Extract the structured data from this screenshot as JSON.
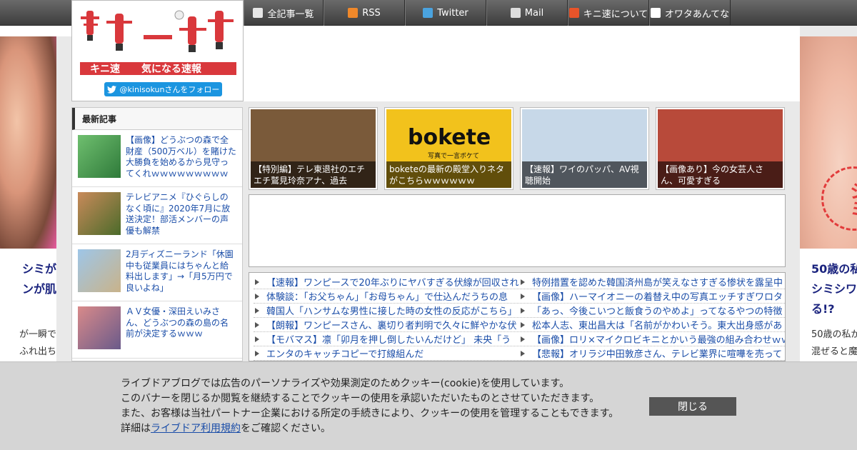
{
  "nav": {
    "items": [
      {
        "label": "全記事一覧",
        "icon": "document-icon",
        "color": "#e6e6e6",
        "width": 112
      },
      {
        "label": "RSS",
        "icon": "rss-icon",
        "color": "#f0882a",
        "width": 114
      },
      {
        "label": "Twitter",
        "icon": "twitter-icon",
        "color": "#4aa3df",
        "width": 114
      },
      {
        "label": "Mail",
        "icon": "mail-icon",
        "color": "#dddddd",
        "width": 114
      },
      {
        "label": "キニ速について",
        "icon": "kini-logo-icon",
        "color": "#e8542a",
        "width": 114
      },
      {
        "label": "オワタあんてな",
        "icon": "face-icon",
        "color": "#ffffff",
        "width": 114
      }
    ]
  },
  "logo": {
    "name": "キニ速",
    "tagline": "気になる速報",
    "follow_label": "@kinisokunさんをフォロー"
  },
  "left_ad": {
    "title_lines": [
      "シミが",
      "ンが肌"
    ],
    "text_lines": [
      "が一瞬で",
      "ふれ出ち"
    ]
  },
  "right_ad": {
    "circle_text": "シミ",
    "title_lines": [
      "50歳の私",
      "シミシワ",
      "る!?"
    ],
    "text_lines": [
      "50歳の私が",
      "混ぜると魔"
    ]
  },
  "recent": {
    "header": "最新記事",
    "items": [
      {
        "title": "【画像】どうぶつの森で全財産（500万ベル）を賭けた大勝負を始めるから見守ってくれｗｗｗｗｗｗｗｗｗｗｗｗ",
        "thumb_colors": [
          "#6fbf6f",
          "#2f7a3a"
        ]
      },
      {
        "title": "テレビアニメ『ひぐらしのなく頃に』2020年7月に放送決定！部活メンバーの声優も解禁",
        "thumb_colors": [
          "#c98a5a",
          "#4b6b2a"
        ]
      },
      {
        "title": "2月ディズニーランド「休園中も従業員にはちゃんと給料出します」→「月5万円で良いよね」",
        "thumb_colors": [
          "#9ec6e8",
          "#c9b38a"
        ]
      },
      {
        "title": "ＡＶ女優・深田えいみさん、どうぶつの森の島の名前が決定するｗｗｗ",
        "thumb_colors": [
          "#d98a8a",
          "#6a5a8a"
        ]
      }
    ]
  },
  "featured": [
    {
      "caption": "【特別編】テレ東退社のエチエチ鷲見玲奈アナ、過去",
      "bg": "#7a5a3a"
    },
    {
      "caption": "boketeの最新の殿堂入りネタがこちらｗｗｗｗｗｗ",
      "bg": "#f2c21c",
      "brand": "bokete",
      "brand_sub": "写真で一言ボケて"
    },
    {
      "caption": "【速報】ワイのパッパ、AV視聴開始",
      "bg": "#c7d8e8"
    },
    {
      "caption": "【画像あり】今の女芸人さん、可愛すぎる",
      "bg": "#b84a3a"
    }
  ],
  "links": [
    [
      "【速報】ワンピースで20年ぶりにヤバすぎる伏線が回収され",
      "特例措置を認めた韓国済州島が笑えなさすぎる惨状を露呈中"
    ],
    [
      "体験談：「お父ちゃん」「お母ちゃん」で仕込んだうちの息",
      "【画像】ハーマイオニーの着替え中の写真エッチすぎワロタ"
    ],
    [
      "韓国人「ハンサムな男性に接した時の女性の反応がこちら」",
      "「あっ、今後こいつと飯食うのやめよ」ってなるやつの特徴"
    ],
    [
      "【朗報】ワンピースさん、裏切り者判明で久々に鮮やかな伏",
      "松本人志、東出昌大は「名前がかわいそう。東大出身感があ"
    ],
    [
      "【モバマス】凛「卯月を押し倒したいんだけど」 未央「う",
      "【画像】ロリ×マイクロビキニとかいう最強の組み合わせｗｗ"
    ],
    [
      "エンタのキャッチコピーで打線組んだ",
      "【悲報】オリラジ中田敦彦さん、テレビ業界に喧嘩を売って"
    ]
  ],
  "cookie": {
    "line1": "ライブドアブログでは広告のパーソナライズや効果測定のためクッキー(cookie)を使用しています。",
    "line2": "このバナーを閉じるか閲覧を継続することでクッキーの使用を承認いただいたものとさせていただきます。",
    "line3": "また、お客様は当社パートナー企業における所定の手続きにより、クッキーの使用を管理することもできます。",
    "line4_prefix": "詳細は",
    "line4_link": "ライブドア利用規約",
    "line4_suffix": "をご確認ください。",
    "close_label": "閉じる"
  }
}
